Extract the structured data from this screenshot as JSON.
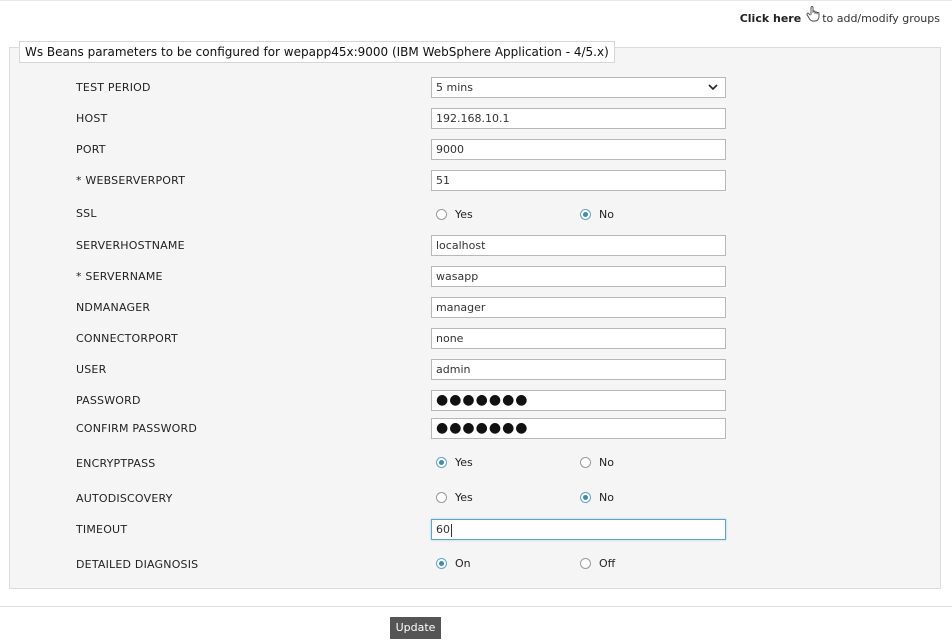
{
  "header": {
    "click_here": "Click here",
    "groups_text": "to add/modify groups",
    "hand_icon": "hand-pointer-icon"
  },
  "panel": {
    "legend": "Ws Beans parameters to be configured for wepapp45x:9000 (IBM WebSphere Application - 4/5.x)"
  },
  "form": {
    "test_period": {
      "label": "TEST PERIOD",
      "value": "5 mins"
    },
    "host": {
      "label": "HOST",
      "value": "192.168.10.1"
    },
    "port": {
      "label": "PORT",
      "value": "9000"
    },
    "webserverport": {
      "label": "* WEBSERVERPORT",
      "value": "51"
    },
    "ssl": {
      "label": "SSL",
      "options": [
        "Yes",
        "No"
      ],
      "selected": "No"
    },
    "serverhostname": {
      "label": "SERVERHOSTNAME",
      "value": "localhost"
    },
    "servername": {
      "label": "* SERVERNAME",
      "value": "wasapp"
    },
    "ndmanager": {
      "label": "NDMANAGER",
      "value": "manager"
    },
    "connectorport": {
      "label": "CONNECTORPORT",
      "value": "none"
    },
    "user": {
      "label": "USER",
      "value": "admin"
    },
    "password": {
      "label": "PASSWORD",
      "masked": "●●●●●●●"
    },
    "confirm_password": {
      "label": "CONFIRM PASSWORD",
      "masked": "●●●●●●●"
    },
    "encryptpass": {
      "label": "ENCRYPTPASS",
      "options": [
        "Yes",
        "No"
      ],
      "selected": "Yes"
    },
    "autodiscovery": {
      "label": "AUTODISCOVERY",
      "options": [
        "Yes",
        "No"
      ],
      "selected": "No"
    },
    "timeout": {
      "label": "TIMEOUT",
      "value": "60"
    },
    "detailed_diagnosis": {
      "label": "DETAILED DIAGNOSIS",
      "options": [
        "On",
        "Off"
      ],
      "selected": "On"
    }
  },
  "footer": {
    "update_label": "Update"
  },
  "colors": {
    "accent": "#3d8db2",
    "button_bg": "#555555",
    "panel_bg": "#f5f5f5"
  }
}
